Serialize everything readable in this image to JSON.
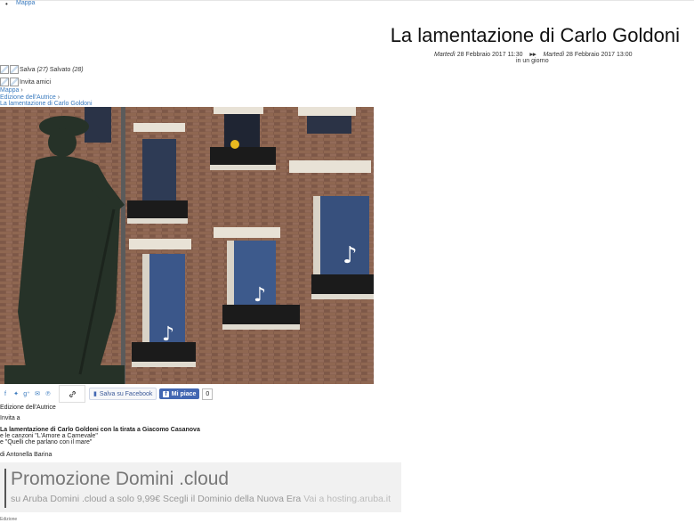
{
  "nav": {
    "map_link": "Mappa"
  },
  "event": {
    "title": "La lamentazione di Carlo Goldoni",
    "start_day": "Martedì",
    "start_date": "28 Febbraio",
    "start_year": "2017",
    "start_time": "11:30",
    "end_day": "Martedì",
    "end_date": "28 Febbraio",
    "end_year": "2017",
    "end_time": "13:00",
    "duration": "in un giorno"
  },
  "actions": {
    "save_label": "Salva",
    "save_count": "(27)",
    "saved_label": "Salvato",
    "saved_count": "(28)",
    "invite_label": "Invita amici"
  },
  "breadcrumb": {
    "items": [
      "Mappa",
      "Edizione dell'Autrice",
      "La lamentazione di Carlo Goldoni"
    ],
    "separator": "›"
  },
  "share": {
    "icons": [
      "facebook-icon",
      "twitter-icon",
      "google-plus-icon",
      "email-icon",
      "pinterest-icon"
    ],
    "save_fb_label": "Salva su Facebook",
    "like_label": "Mi piace",
    "like_count": "0"
  },
  "body": {
    "organizer": "Edizione dell'Autrice",
    "invite": "Invita a",
    "line1": "La lamentazione di Carlo Goldoni con la tirata a Giacomo Casanova",
    "line2": "e le canzoni \"L'Amore a Carnevale\"",
    "line3": "e \"Quelli che parlano con il mare\"",
    "author": "di Antonella Barina"
  },
  "ad": {
    "title": "Promozione Domini .cloud",
    "text": "su Aruba Domini .cloud a solo 9,99€ Scegli il Dominio della Nuova Era",
    "url": "Vai a hosting.aruba.it"
  },
  "footer": {
    "text": "Edizione"
  },
  "colors": {
    "link": "#3b7bbf",
    "facebook": "#4267b2",
    "ad_bg": "#f1f1f1"
  }
}
